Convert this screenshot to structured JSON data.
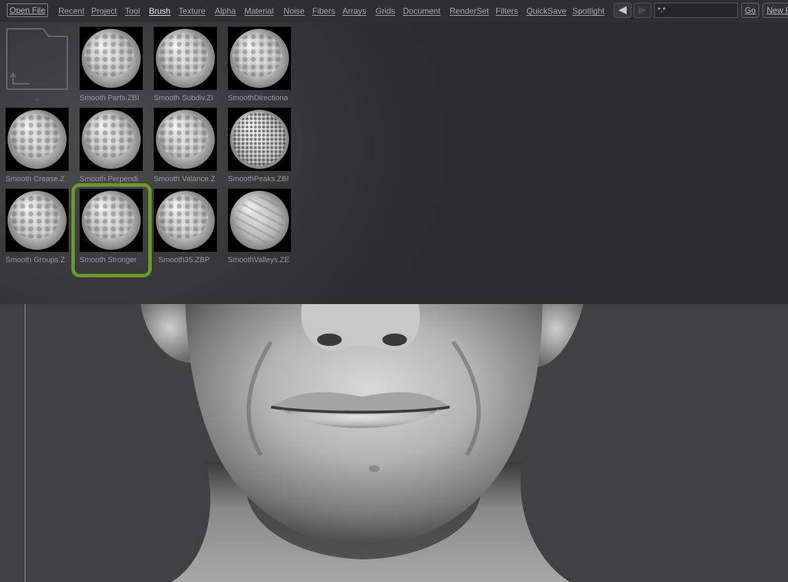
{
  "menu": {
    "open_file": "Open File",
    "items": [
      "Recent",
      "Project",
      "Tool",
      "Brush",
      "Texture",
      "Alpha",
      "Material",
      "Noise",
      "Fibers",
      "Arrays",
      "Grids",
      "Document",
      "RenderSet",
      "Filters",
      "QuickSave",
      "Spotlight"
    ],
    "active": "Brush",
    "search_value": "*.*",
    "go_label": "Go",
    "new_label": "New F"
  },
  "browser": {
    "parent_label": "..",
    "tiles": [
      {
        "label": "Smooth Parts.ZBI",
        "style": "bumpy"
      },
      {
        "label": "Smooth Subdiv.ZI",
        "style": "bumpy"
      },
      {
        "label": "SmoothDirectiona",
        "style": "bumpy"
      },
      {
        "label": "Smooth Crease.Z",
        "style": "bumpy"
      },
      {
        "label": "Smooth Perpendi",
        "style": "bumpy"
      },
      {
        "label": "Smooth Valance.Z",
        "style": "bumpy"
      },
      {
        "label": "SmoothPeaks.ZBI",
        "style": "peaks"
      },
      {
        "label": "Smooth Groups.Z",
        "style": "bumpy"
      },
      {
        "label": "Smooth Stronger",
        "style": "bumpy"
      },
      {
        "label": "Smooth35.ZBP",
        "style": "bumpy"
      },
      {
        "label": "SmoothValleys.ZE",
        "style": "valleys"
      }
    ],
    "highlighted": "Smooth Stronger"
  },
  "colors": {
    "highlight": "#6a9a2c",
    "panel_bg": "#2f2f31",
    "viewport_bg": "#414143"
  },
  "icons": {
    "parent_folder": "folder-up-icon",
    "back": "arrow-left-icon",
    "forward": "arrow-right-icon"
  }
}
